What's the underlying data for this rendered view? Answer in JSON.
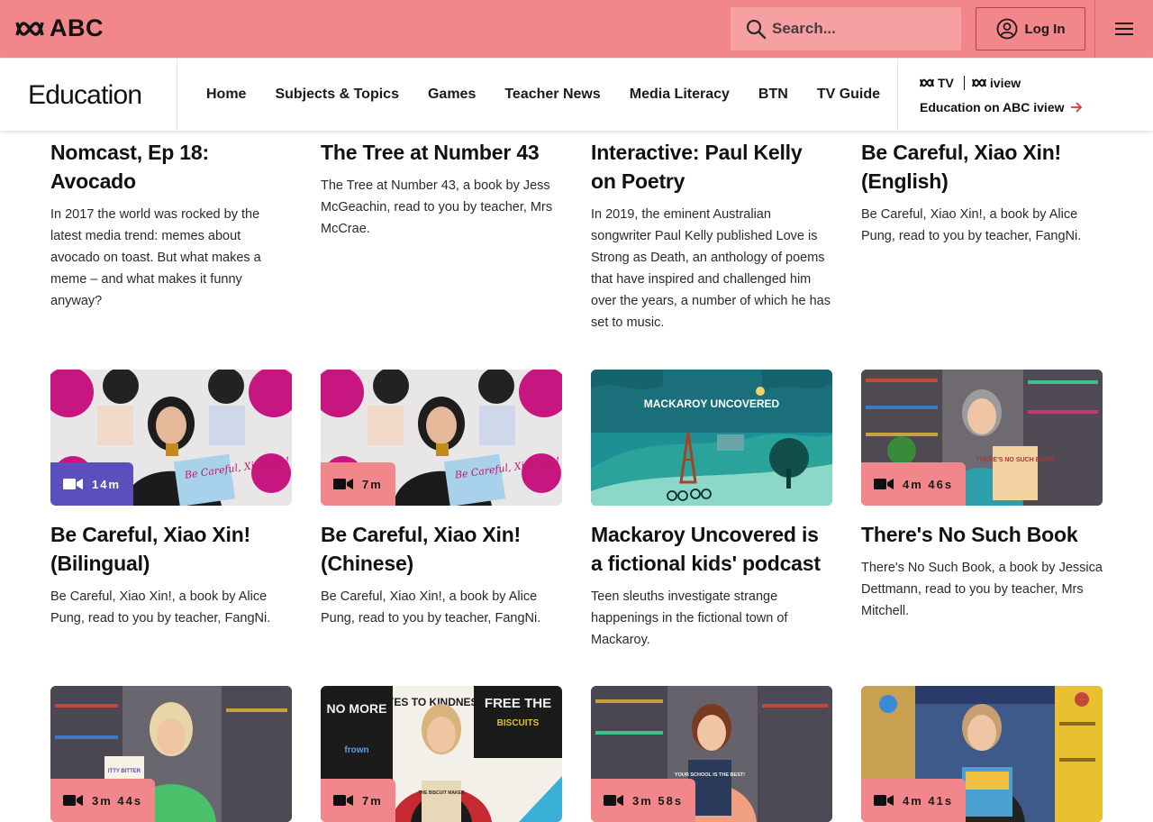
{
  "header": {
    "logo_text": "ABC",
    "search_placeholder": "Search...",
    "login_label": "Log In",
    "brand_color": "#f2878b"
  },
  "nav": {
    "section_title": "Education",
    "links": [
      "Home",
      "Subjects & Topics",
      "Games",
      "Teacher News",
      "Media Literacy",
      "BTN",
      "TV Guide"
    ],
    "iview_logo_tv": "TV",
    "iview_logo_iview": "iview",
    "iview_link": "Education on ABC iview"
  },
  "cards_row1": [
    {
      "title": "Nomcast, Ep 18: Avocado",
      "desc": "In 2017 the world was rocked by the latest media trend: memes about avocado on toast. But what makes a meme – and what makes it funny anyway?"
    },
    {
      "title": "The Tree at Number 43",
      "desc": "The Tree at Number 43, a book by Jess McGeachin, read to you by teacher, Mrs McCrae."
    },
    {
      "title": "Interactive: Paul Kelly on Poetry",
      "desc": "In 2019, the eminent Australian songwriter Paul Kelly published Love is Strong as Death, an anthology of poems that have inspired and challenged him over the years, a number of which he has set to music."
    },
    {
      "title": "Be Careful, Xiao Xin! (English)",
      "desc": "Be Careful, Xiao Xin!, a book by Alice Pung, read to you by teacher, FangNi."
    }
  ],
  "cards_row2": [
    {
      "title": "Be Careful, Xiao Xin! (Bilingual)",
      "desc": "Be Careful, Xiao Xin!, a book by Alice Pung, read to you by teacher, FangNi.",
      "duration": "14m",
      "badge_style": "purple"
    },
    {
      "title": "Be Careful, Xiao Xin! (Chinese)",
      "desc": "Be Careful, Xiao Xin!, a book by Alice Pung, read to you by teacher, FangNi.",
      "duration": "7m",
      "badge_style": "pink"
    },
    {
      "title": "Mackaroy Uncovered is a fictional kids' podcast",
      "desc": "Teen sleuths investigate strange happenings in the fictional town of Mackaroy.",
      "thumb_title": "MACKAROY UNCOVERED"
    },
    {
      "title": "There's No Such Book",
      "desc": "There's No Such Book, a book by Jessica Dettmann, read to you by teacher, Mrs Mitchell.",
      "duration": "4m 46s",
      "badge_style": "pink"
    }
  ],
  "cards_row3": [
    {
      "duration": "3m 44s"
    },
    {
      "duration": "7m"
    },
    {
      "duration": "3m 58s"
    },
    {
      "duration": "4m 41s"
    }
  ],
  "thumb_text": {
    "book_title": "Be Careful, Xiao Xin!",
    "no_such_book": "THERE'S NO SUCH BOOK",
    "yes_to_kindness": "YES TO KINDNESS",
    "no_more": "NO MORE",
    "free_the": "FREE THE",
    "biscuits": "BISCUITS",
    "frown": "frown",
    "biscuit_maker": "THE BISCUIT MAKER",
    "your_school": "YOUR SCHOOL IS THE BEST!",
    "itty_bitter": "ITTY BITTER"
  }
}
